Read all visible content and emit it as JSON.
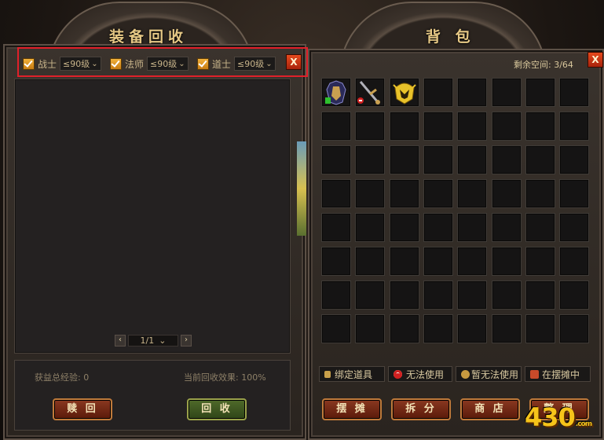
{
  "recycle": {
    "title": "装备回收",
    "close": "X",
    "filters": [
      {
        "label": "战士",
        "level": "≤90级"
      },
      {
        "label": "法师",
        "level": "≤90级"
      },
      {
        "label": "道士",
        "level": "≤90级"
      }
    ],
    "pager": {
      "prev": "‹",
      "page": "1/1",
      "next": "›"
    },
    "total_exp": "获益总经验: 0",
    "efficiency": "当前回收效果: 100%",
    "redeem_label": "赎 回",
    "recycle_label": "回 收"
  },
  "bag": {
    "title": "背 包",
    "close": "X",
    "space": "剩余空间: 3/64",
    "legend": [
      {
        "label": "绑定道具",
        "icon": "lock-icon",
        "color": "#c8a04a"
      },
      {
        "label": "无法使用",
        "icon": "no-entry-icon",
        "color": "#d02020"
      },
      {
        "label": "暂无法使用",
        "icon": "pause-dot-icon",
        "color": "#c89a40"
      },
      {
        "label": "在摆摊中",
        "icon": "stall-icon",
        "color": "#c84a2a"
      }
    ],
    "buttons": [
      "摆 摊",
      "拆 分",
      "商 店",
      "整 理"
    ],
    "items": [
      {
        "name": "armor-item",
        "icon": "armor-icon"
      },
      {
        "name": "sword-item",
        "icon": "sword-icon"
      },
      {
        "name": "helmet-item",
        "icon": "helmet-icon"
      }
    ]
  },
  "logo": {
    "text": "430",
    "suffix": ".com"
  }
}
